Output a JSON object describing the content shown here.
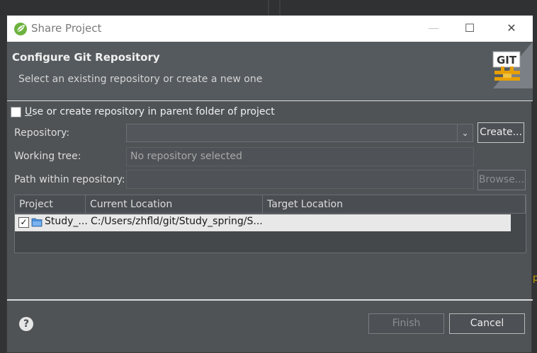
{
  "window": {
    "title": "Share Project",
    "controls": {
      "minimize": "—",
      "maximize": "☐",
      "close": "✕"
    }
  },
  "header": {
    "title": "Configure Git Repository",
    "subtitle": "Select an existing repository or create a new one",
    "badge_text": "GIT"
  },
  "form": {
    "parent_checkbox": {
      "checked": false,
      "label_underlined": "U",
      "label_rest": "se or create repository in parent folder of project"
    },
    "repository": {
      "label": "Repository:",
      "value": "",
      "create_button": "Create..."
    },
    "working_tree": {
      "label": "Working tree:",
      "value": "No repository selected"
    },
    "path_within_repo": {
      "label": "Path within repository:",
      "value": "",
      "browse_button": "Browse..."
    }
  },
  "table": {
    "columns": [
      "Project",
      "Current Location",
      "Target Location"
    ],
    "rows": [
      {
        "checked": true,
        "project": "Study_...",
        "current_location": "C:/Users/zhfld/git/Study_spring/S...",
        "target_location": ""
      }
    ]
  },
  "footer": {
    "help_icon": "?",
    "finish_button": "Finish",
    "cancel_button": "Cancel"
  },
  "colors": {
    "dialog_bg": "#505356",
    "header_bg": "#555a5e",
    "titlebar_bg": "#ffffff",
    "selected_row_bg": "#e8e8e8",
    "badge_accent": "#e8a000"
  }
}
